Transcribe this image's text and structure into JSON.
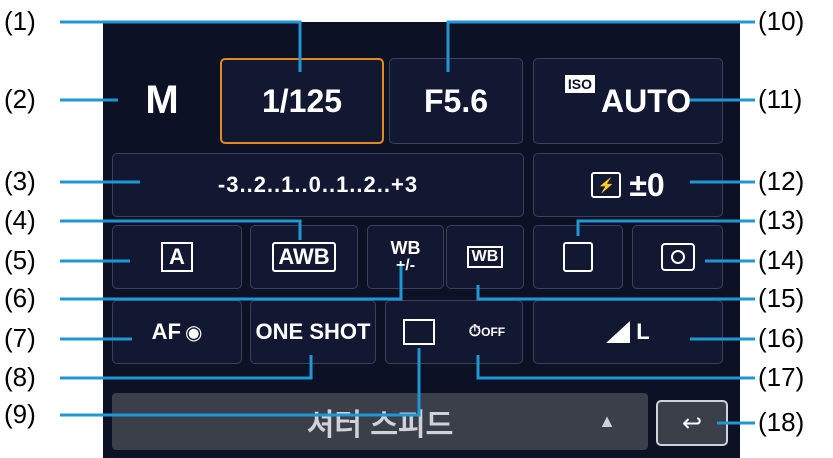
{
  "mode": "M",
  "shutter_speed": "1/125",
  "aperture": "F5.6",
  "iso": {
    "tag": "ISO",
    "value": "AUTO"
  },
  "exposure_scale": "-3..2..1..0..1..2..+3",
  "flash_comp": "±0",
  "picture_style": "A",
  "wb": "AWB",
  "wb_shift": {
    "top": "WB",
    "bottom": "+/-"
  },
  "wb_bracket": "WB",
  "af_method": "AF",
  "af_operation": "ONE SHOT",
  "drive": "",
  "selftimer": "OFF",
  "quality": "L",
  "status_text": "셔터 스피드",
  "callouts": [
    "(1)",
    "(2)",
    "(3)",
    "(4)",
    "(5)",
    "(6)",
    "(7)",
    "(8)",
    "(9)",
    "(10)",
    "(11)",
    "(12)",
    "(13)",
    "(14)",
    "(15)",
    "(16)",
    "(17)",
    "(18)"
  ],
  "colors": {
    "accent": "#e38a1f",
    "screen": "#0c1125",
    "leader": "#1e97d4"
  }
}
